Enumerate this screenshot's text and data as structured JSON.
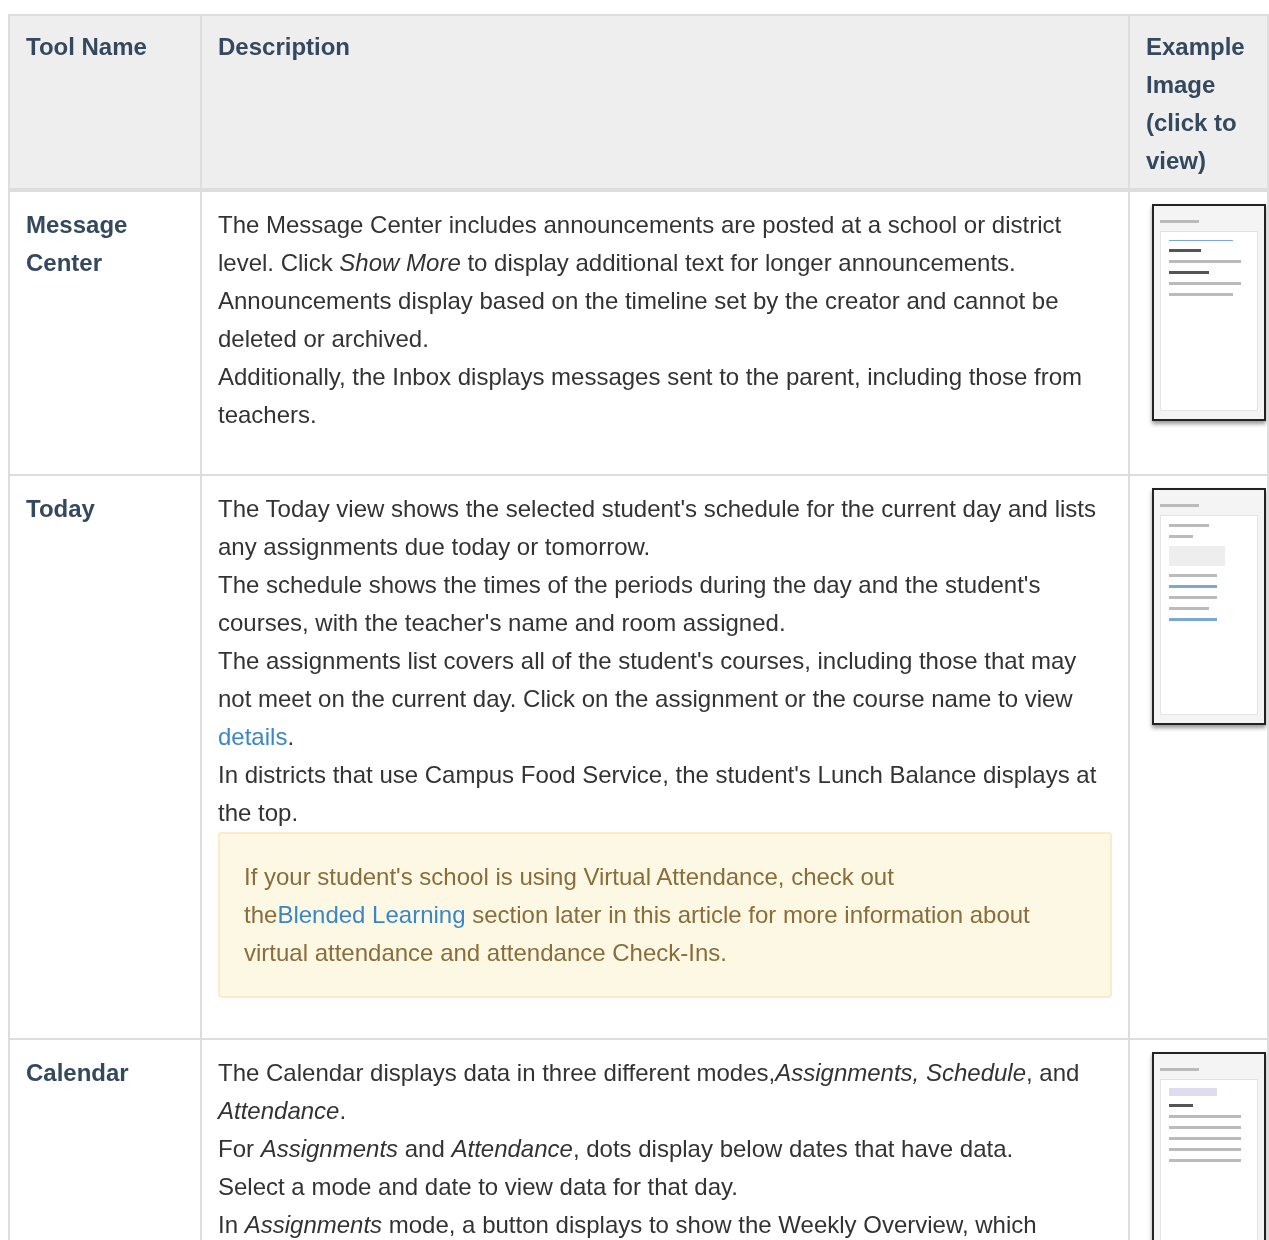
{
  "table": {
    "columns": [
      "Tool Name",
      "Description",
      "Example Image (click to view)"
    ],
    "rows": [
      {
        "tool": "Message Center",
        "image": {
          "kind": "message"
        },
        "paragraphs": [
          [
            {
              "kind": "text",
              "text": "The Message Center includes announcements are posted at a school or district level. Click *Show More* to display additional text for longer announcements. Announcements display based on the timeline set by the creator and cannot be deleted or archived."
            }
          ],
          [
            {
              "kind": "text",
              "text": "Additionally, the Inbox displays messages sent to the parent, including those from teachers."
            }
          ]
        ]
      },
      {
        "tool": "Today",
        "image": {
          "kind": "today"
        },
        "paragraphs": [
          [
            {
              "kind": "text",
              "text": "The Today view shows the selected student's schedule for the current day and lists any assignments due today or tomorrow."
            }
          ],
          [
            {
              "kind": "text",
              "text": "The schedule shows the times of the periods during the day and the student's courses, with the teacher's name and room assigned."
            }
          ],
          [
            {
              "kind": "text",
              "text": "The assignments list covers all of the student's courses, including those that may not meet on the current day. Click on the assignment or the course name to view "
            },
            {
              "kind": "link",
              "text": "details"
            },
            {
              "kind": "text",
              "text": "."
            }
          ],
          [
            {
              "kind": "text",
              "text": "In districts that use Campus Food Service, the student's Lunch Balance displays at the top."
            }
          ]
        ],
        "callout": [
          {
            "kind": "text",
            "text": "If your student's school is using Virtual Attendance, check out the"
          },
          {
            "kind": "link",
            "text": "Blended Learning"
          },
          {
            "kind": "text",
            "text": " section later in this article for more information about virtual attendance and attendance Check-Ins."
          }
        ]
      },
      {
        "tool": "Calendar",
        "image": {
          "kind": "calendar"
        },
        "paragraphs": [
          [
            {
              "kind": "text",
              "text": "The Calendar displays data in three different modes,*Assignments, Schedule*, and *Attendance*."
            }
          ],
          [
            {
              "kind": "text",
              "text": "For *Assignments* and *Attendance*, dots display below dates that have data."
            }
          ],
          [
            {
              "kind": "text",
              "text": "Select a mode and date to view data for that day."
            }
          ],
          [
            {
              "kind": "text",
              "text": "In *Assignments* mode, a button displays to show the Weekly Overview, which"
            }
          ]
        ]
      }
    ]
  }
}
